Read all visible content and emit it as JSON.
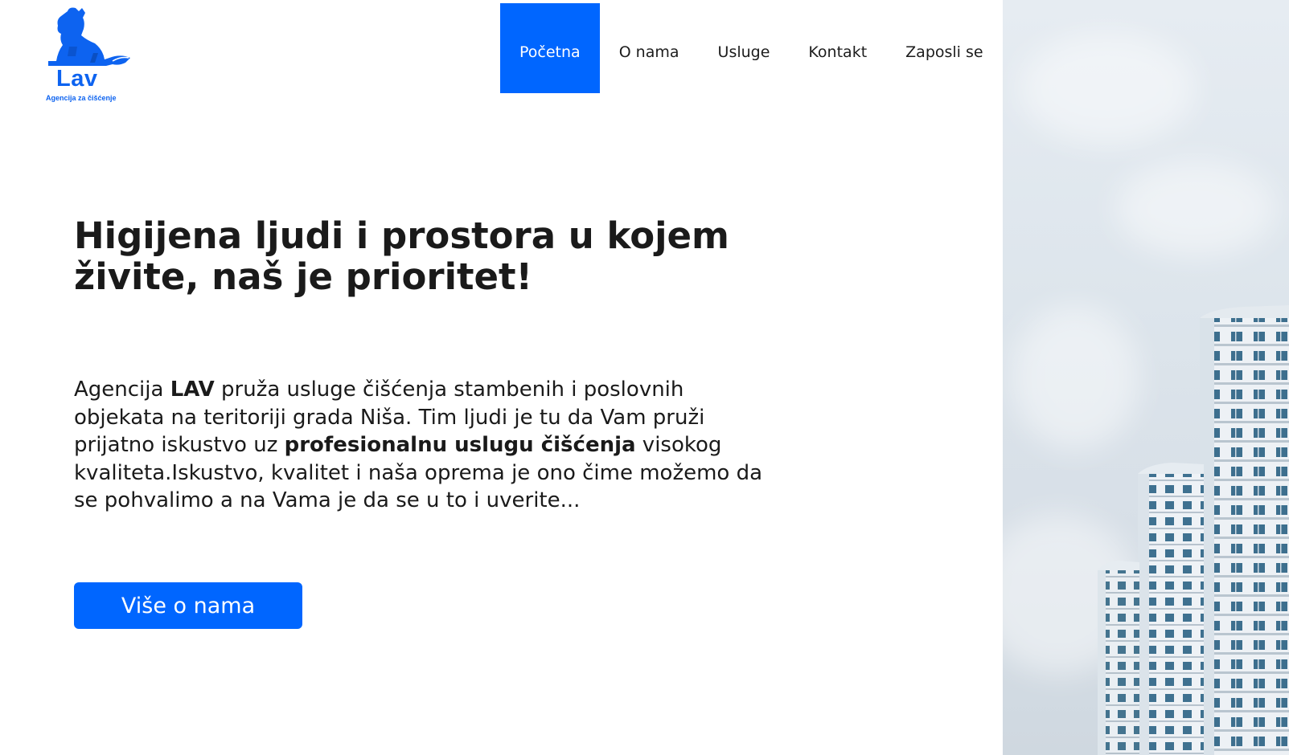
{
  "logo": {
    "name": "Lav",
    "tagline": "Agencija za čišćenje"
  },
  "nav": {
    "items": [
      {
        "label": "Početna",
        "active": true
      },
      {
        "label": "O nama",
        "active": false
      },
      {
        "label": "Usluge",
        "active": false
      },
      {
        "label": "Kontakt",
        "active": false
      },
      {
        "label": "Zaposli se",
        "active": false
      }
    ]
  },
  "hero": {
    "title": "Higijena ljudi i prostora u kojem živite, naš je prioritet!",
    "text": {
      "p1": "Agencija ",
      "brand": "LAV",
      "p2": " pruža usluge čišćenja stambenih i poslovnih objekata na teritoriji grada Niša. Tim ljudi je tu da Vam pruži prijatno iskustvo uz ",
      "highlight": "profesionalnu uslugu čišćenja",
      "p3": " visokog kvaliteta.Iskustvo, kvalitet i naša oprema je ono čime možemo da se pohvalimo a na Vama je da se u to i uverite..."
    },
    "cta_label": "Više o nama"
  },
  "colors": {
    "accent": "#0066ff",
    "logo": "#0d63f0",
    "text": "#1a1a1a"
  }
}
